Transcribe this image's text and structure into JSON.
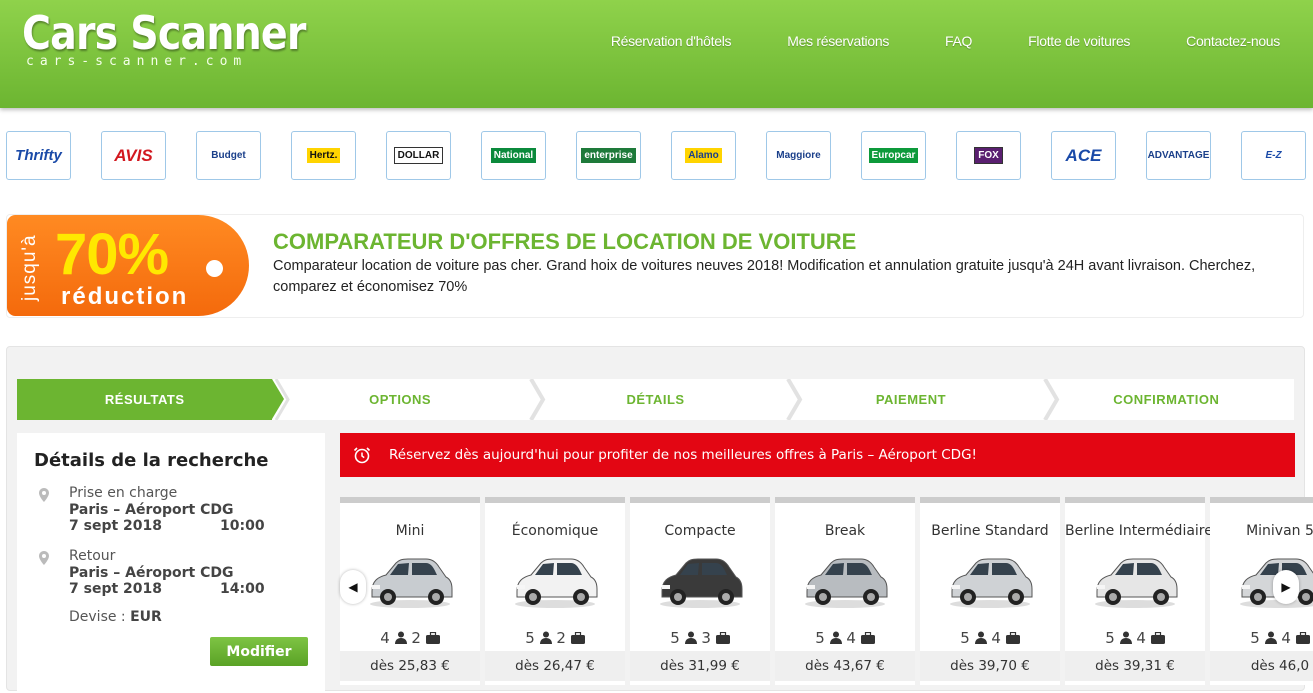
{
  "header": {
    "logo_title": "Cars Scanner",
    "logo_sub": "cars-scanner.com",
    "nav": [
      "Réservation d'hôtels",
      "Mes réservations",
      "FAQ",
      "Flotte de voitures",
      "Contactez-nous"
    ]
  },
  "brands": [
    {
      "name": "Thrifty",
      "color": "#1a4aa8",
      "bg": "#ffffff"
    },
    {
      "name": "AVIS",
      "color": "#d2181f",
      "bg": "#ffffff"
    },
    {
      "name": "Budget",
      "color": "#1a3f8a",
      "bg": "#ffffff"
    },
    {
      "name": "Hertz.",
      "color": "#111111",
      "bg": "#ffd400"
    },
    {
      "name": "DOLLAR",
      "color": "#111111",
      "bg": "#ffffff"
    },
    {
      "name": "National",
      "color": "#ffffff",
      "bg": "#0b8a3c"
    },
    {
      "name": "enterprise",
      "color": "#ffffff",
      "bg": "#1e7a3a"
    },
    {
      "name": "Alamo",
      "color": "#1a3f8a",
      "bg": "#ffd400"
    },
    {
      "name": "Maggiore",
      "color": "#1a3f8a",
      "bg": "#ffffff"
    },
    {
      "name": "Europcar",
      "color": "#ffffff",
      "bg": "#0d9a3b"
    },
    {
      "name": "FOX",
      "color": "#ffffff",
      "bg": "#5a1f70"
    },
    {
      "name": "ACE",
      "color": "#1a4aa8",
      "bg": "#ffffff"
    },
    {
      "name": "ADVANTAGE",
      "color": "#1a3f8a",
      "bg": "#ffffff"
    },
    {
      "name": "E-Z",
      "color": "#1a4aa8",
      "bg": "#ffffff"
    }
  ],
  "promo": {
    "badge_jusqu": "jusqu'à",
    "badge_pct": "70%",
    "badge_reduction": "réduction",
    "title": "COMPARATEUR D'OFFRES DE LOCATION DE VOITURE",
    "text": "Comparateur location de voiture pas cher. Grand hoix de voitures neuves 2018! Modification et annulation gratuite jusqu'à 24H avant livraison. Cherchez, comparez et économisez 70%"
  },
  "steps": [
    "RÉSULTATS",
    "OPTIONS",
    "DÉTAILS",
    "PAIEMENT",
    "CONFIRMATION"
  ],
  "search": {
    "title": "Détails de la recherche",
    "pickup_label": "Prise en charge",
    "pickup_place": "Paris – Aéroport CDG",
    "pickup_date": "7 sept 2018",
    "pickup_time": "10:00",
    "return_label": "Retour",
    "return_place": "Paris – Aéroport CDG",
    "return_date": "7 sept 2018",
    "return_time": "14:00",
    "currency_label": "Devise :",
    "currency": "EUR",
    "modify_button": "Modifier"
  },
  "alert": {
    "text": "Réservez dès aujourd'hui pour profiter de nos meilleures offres à Paris – Aéroport CDG!",
    "color": "#e30613"
  },
  "cars": [
    {
      "name": "Mini",
      "seats": "4",
      "bags": "2",
      "price": "dès 25,83 €",
      "car_color": "#c8ccd0"
    },
    {
      "name": "Économique",
      "seats": "5",
      "bags": "2",
      "price": "dès 26,47 €",
      "car_color": "#f2f2f2"
    },
    {
      "name": "Compacte",
      "seats": "5",
      "bags": "3",
      "price": "dès 31,99 €",
      "car_color": "#3a3a3a"
    },
    {
      "name": "Break",
      "seats": "5",
      "bags": "4",
      "price": "dès 43,67 €",
      "car_color": "#b8bcc0"
    },
    {
      "name": "Berline Standard",
      "seats": "5",
      "bags": "4",
      "price": "dès 39,70 €",
      "car_color": "#cfd2d5"
    },
    {
      "name": "Berline Intermédiaire",
      "seats": "5",
      "bags": "4",
      "price": "dès 39,31 €",
      "car_color": "#e6e6e6"
    },
    {
      "name": "Minivan 5",
      "seats": "5",
      "bags": "4",
      "price": "dès 46,0",
      "car_color": "#d4d6d8"
    }
  ],
  "accent_color": "#6cb531"
}
